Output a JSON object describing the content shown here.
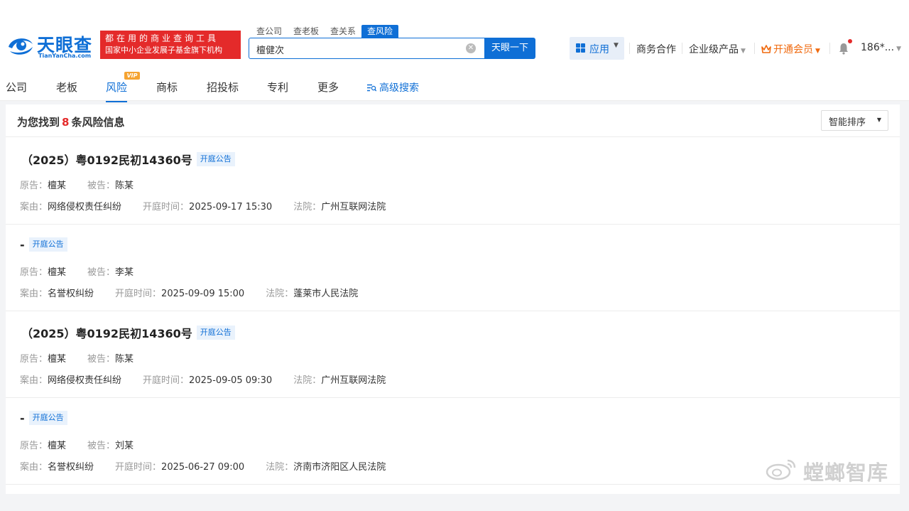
{
  "brand": {
    "name": "天眼查",
    "sub": "TianYanCha.com",
    "slogan_line1": "都在用的商业查询工具",
    "slogan_line2": "国家中小企业发展子基金旗下机构",
    "color": "#0f6fd6"
  },
  "search": {
    "tabs": [
      "查公司",
      "查老板",
      "查关系",
      "查风险"
    ],
    "active_tab": "查风险",
    "value": "檀健次",
    "button": "天眼一下"
  },
  "topnav": {
    "app": "应用",
    "business": "商务合作",
    "enterprise": "企业级产品",
    "vip": "开通会员",
    "user": "186*..."
  },
  "subnav": {
    "items": [
      "公司",
      "老板",
      "风险",
      "商标",
      "招投标",
      "专利",
      "更多"
    ],
    "active": "风险",
    "vip_badge": "VIP",
    "advanced": "高级搜索"
  },
  "results": {
    "prefix": "为您找到",
    "count": "8",
    "suffix": "条风险信息",
    "sort_label": "智能排序",
    "labels": {
      "plaintiff": "原告：",
      "defendant": "被告：",
      "cause": "案由：",
      "time": "开庭时间：",
      "court": "法院："
    },
    "items": [
      {
        "title": "（2025）粤0192民初14360号",
        "tag": "开庭公告",
        "plaintiff": "檀某",
        "defendant": "陈某",
        "cause": "网络侵权责任纠纷",
        "time": "2025-09-17 15:30",
        "court": "广州互联网法院"
      },
      {
        "title": "-",
        "tag": "开庭公告",
        "plaintiff": "檀某",
        "defendant": "李某",
        "cause": "名誉权纠纷",
        "time": "2025-09-09 15:00",
        "court": "蓬莱市人民法院"
      },
      {
        "title": "（2025）粤0192民初14360号",
        "tag": "开庭公告",
        "plaintiff": "檀某",
        "defendant": "陈某",
        "cause": "网络侵权责任纠纷",
        "time": "2025-09-05 09:30",
        "court": "广州互联网法院"
      },
      {
        "title": "-",
        "tag": "开庭公告",
        "plaintiff": "檀某",
        "defendant": "刘某",
        "cause": "名誉权纠纷",
        "time": "2025-06-27 09:00",
        "court": "济南市济阳区人民法院"
      }
    ]
  },
  "watermark": {
    "text": "螳螂智库"
  },
  "icons": {
    "logo": "eye-logo-icon",
    "clear": "clear-circle-icon",
    "app": "grid-icon",
    "crown": "crown-icon",
    "bell": "bell-icon",
    "advanced": "filter-search-icon",
    "weibo": "weibo-icon"
  }
}
